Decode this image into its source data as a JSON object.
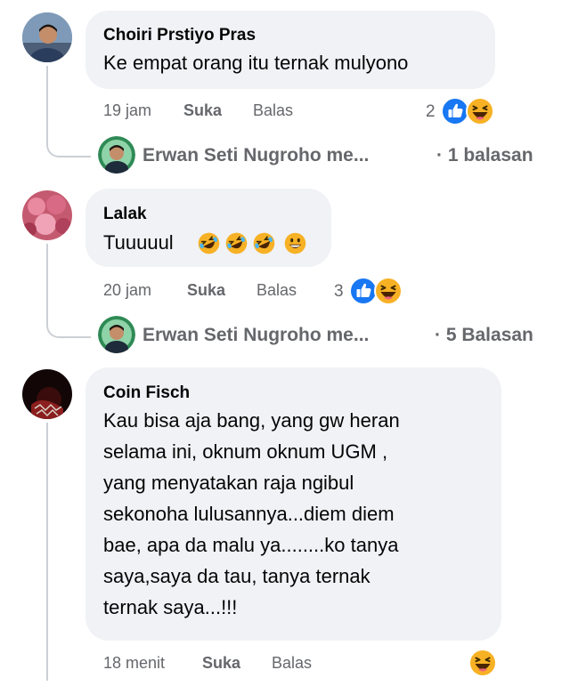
{
  "comments": [
    {
      "author": "Choiri Prstiyo Pras",
      "text_lines": [
        "Ke empat orang itu ternak mulyono"
      ],
      "time": "19 jam",
      "like": "Suka",
      "reply": "Balas",
      "reaction_count": "2",
      "reaction_icons": [
        "like-icon",
        "haha-icon"
      ],
      "replies": {
        "author": "Erwan Seti Nugroho me...",
        "count": "· 1 balasan"
      }
    },
    {
      "author": "Lalak",
      "text": "Tuuuuul",
      "text_emojis": [
        "rofl-emoji",
        "rofl-emoji",
        "rofl-emoji",
        "grin-emoji"
      ],
      "time": "20 jam",
      "like": "Suka",
      "reply": "Balas",
      "reaction_count": "3",
      "reaction_icons": [
        "like-icon",
        "haha-icon"
      ],
      "replies": {
        "author": "Erwan Seti Nugroho me...",
        "count": "· 5 Balasan"
      }
    },
    {
      "author": "Coin Fisch",
      "text_lines": [
        "Kau bisa aja bang, yang gw heran",
        "selama ini, oknum oknum UGM ,",
        "yang menyatakan raja ngibul",
        "sekonoha lulusannya...diem diem",
        "bae, apa da malu ya........ko tanya",
        "saya,saya da tau, tanya ternak",
        "ternak saya...!!!"
      ],
      "time": "18 menit",
      "like": "Suka",
      "reply": "Balas",
      "reaction_icons": [
        "haha-icon"
      ]
    }
  ],
  "colors": {
    "bubble": "#f0f2f5",
    "meta_text": "#65676b",
    "like_blue": "#1877f2",
    "haha_yellow": "#f7b125",
    "thread_line": "#ccd0d5"
  }
}
